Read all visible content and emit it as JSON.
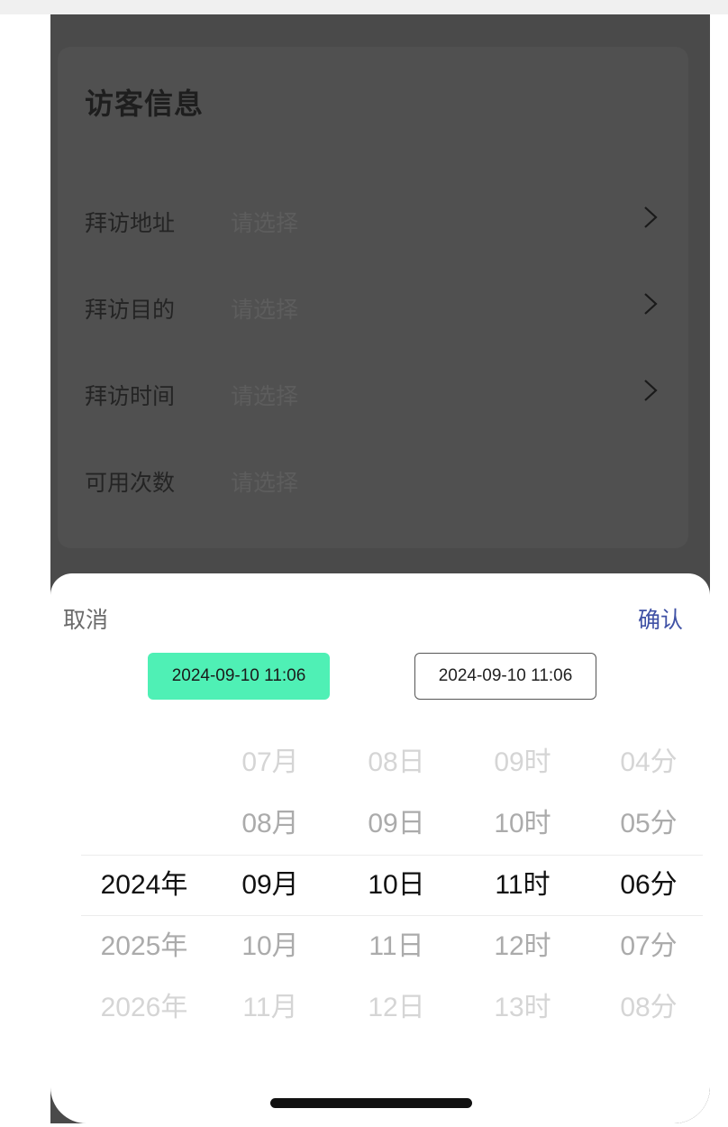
{
  "card": {
    "title": "访客信息",
    "rows": [
      {
        "label": "拜访地址",
        "placeholder": "请选择",
        "has_chevron": true
      },
      {
        "label": "拜访目的",
        "placeholder": "请选择",
        "has_chevron": true
      },
      {
        "label": "拜访时间",
        "placeholder": "请选择",
        "has_chevron": true
      },
      {
        "label": "可用次数",
        "placeholder": "请选择",
        "has_chevron": false
      }
    ]
  },
  "sheet": {
    "cancel_label": "取消",
    "confirm_label": "确认",
    "tabs": [
      {
        "label": "2024-09-10 11:06",
        "active": true
      },
      {
        "label": "2024-09-10 11:06",
        "active": false
      }
    ],
    "picker": {
      "year": [
        "",
        "",
        "2024年",
        "2025年",
        "2026年"
      ],
      "month": [
        "07月",
        "08月",
        "09月",
        "10月",
        "11月"
      ],
      "day": [
        "08日",
        "09日",
        "10日",
        "11日",
        "12日"
      ],
      "hour": [
        "09时",
        "10时",
        "11时",
        "12时",
        "13时"
      ],
      "minute": [
        "04分",
        "05分",
        "06分",
        "07分",
        "08分"
      ]
    }
  },
  "colors": {
    "accent": "#4ff0b5",
    "confirm": "#3f51a5",
    "overlay": "#4a4a4a"
  },
  "icons": {
    "chevron": "chevron-right-icon"
  }
}
